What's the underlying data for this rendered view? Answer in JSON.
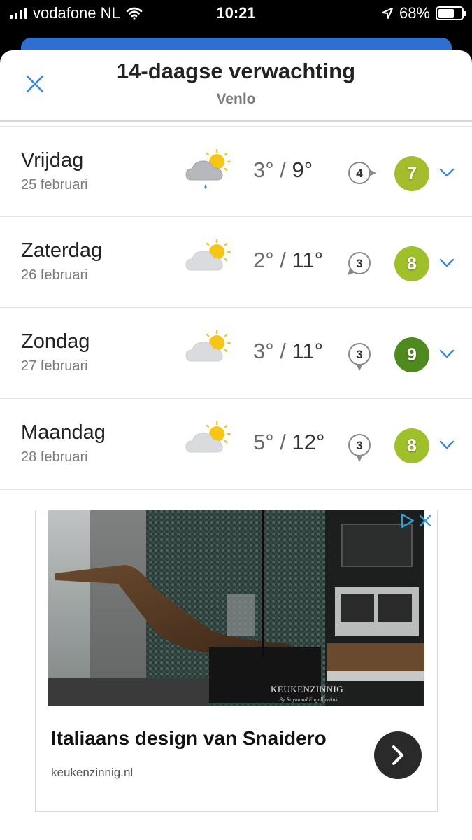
{
  "status_bar": {
    "carrier": "vodafone NL",
    "time": "10:21",
    "battery_percent": "68%",
    "battery_level": 0.68
  },
  "header": {
    "title": "14-daagse verwachting",
    "location": "Venlo",
    "close_icon": "close-icon"
  },
  "forecast": [
    {
      "day": "Vrijdag",
      "date": "25 februari",
      "weather_icon": "rain-cloud-sun-icon",
      "min": "3°",
      "max": "9°",
      "wind": "4",
      "wind_dir": "east",
      "score": "7",
      "score_color": "#a4bd2c"
    },
    {
      "day": "Zaterdag",
      "date": "26 februari",
      "weather_icon": "cloud-sun-icon",
      "min": "2°",
      "max": "11°",
      "wind": "3",
      "wind_dir": "southwest",
      "score": "8",
      "score_color": "#9fbf2b"
    },
    {
      "day": "Zondag",
      "date": "27 februari",
      "weather_icon": "cloud-sun-icon",
      "min": "3°",
      "max": "11°",
      "wind": "3",
      "wind_dir": "south",
      "score": "9",
      "score_color": "#4f8a1f"
    },
    {
      "day": "Maandag",
      "date": "28 februari",
      "weather_icon": "cloud-sun-icon",
      "min": "5°",
      "max": "12°",
      "wind": "3",
      "wind_dir": "south",
      "score": "8",
      "score_color": "#9fbf2b"
    }
  ],
  "colors": {
    "accent": "#2f6fd0",
    "chevron": "#3a86d6"
  },
  "ad": {
    "title": "Italiaans design van Snaidero",
    "domain": "keukenzinnig.nl",
    "brand": "KEUKENZINNIG",
    "brand_sub": "By Raymond Engelbertink",
    "choices_icon": "ad-choices-icon",
    "button_icon": "chevron-right-icon"
  }
}
